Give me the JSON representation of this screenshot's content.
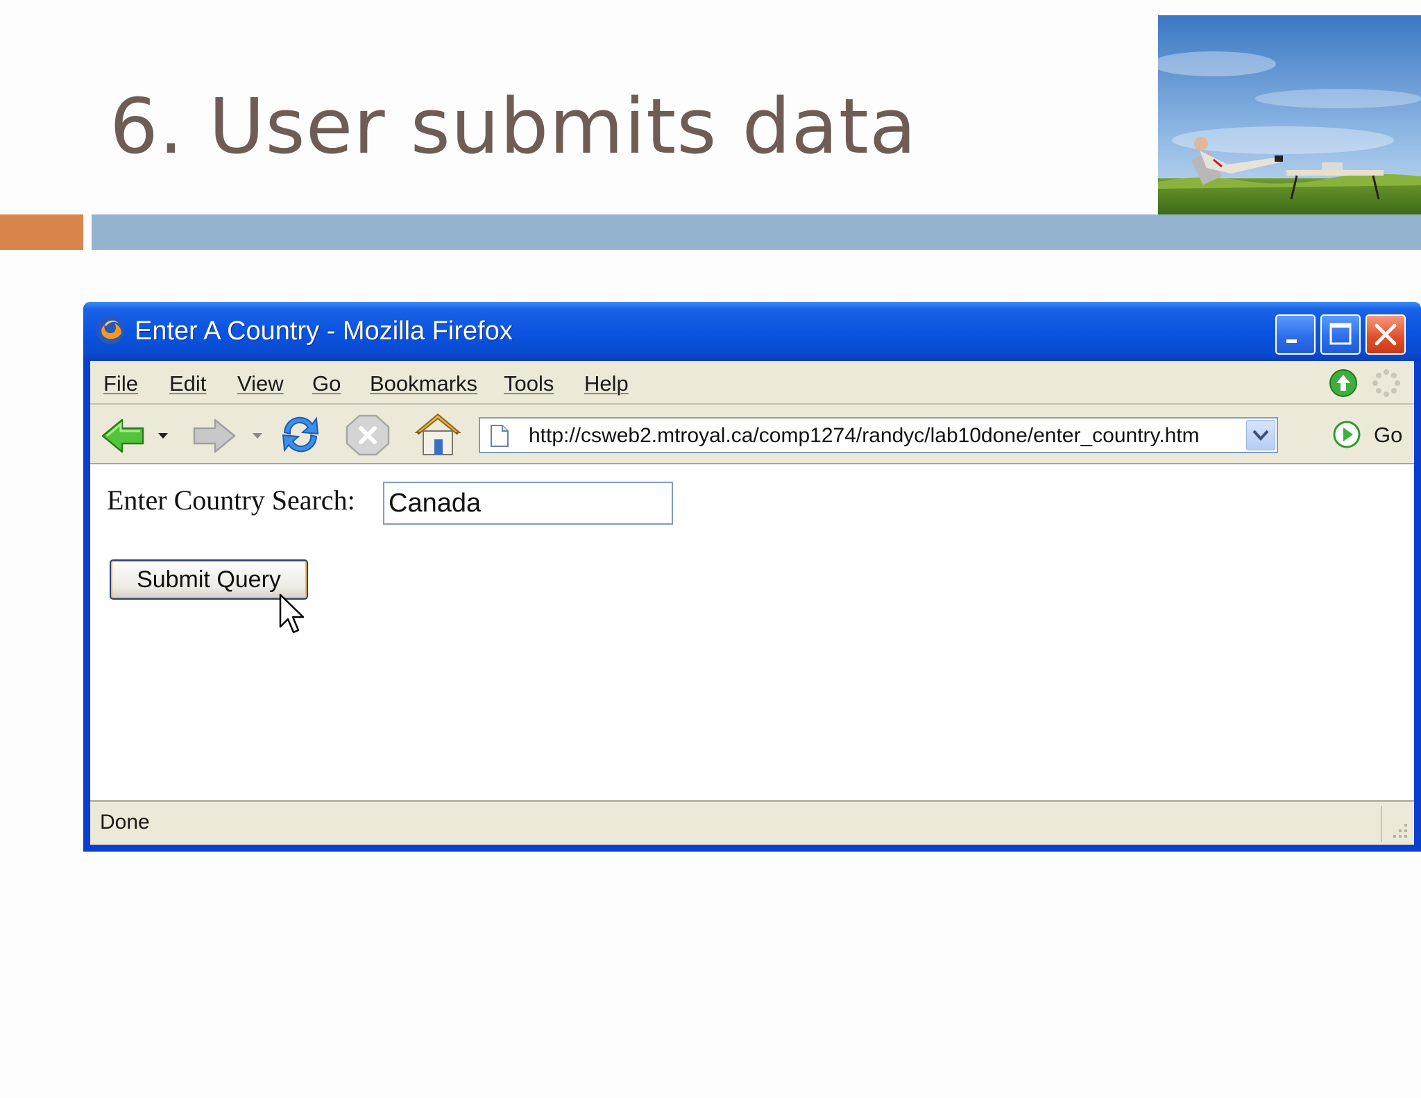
{
  "slide": {
    "title": "6. User submits data"
  },
  "colors": {
    "title": "#6f5d55",
    "accent_orange": "#d9864c",
    "accent_blue": "#95b4cf",
    "xp_blue": "#0a4bd1",
    "xp_chrome": "#ece9d8"
  },
  "browser": {
    "window_title": "Enter A Country - Mozilla Firefox",
    "menu": [
      "File",
      "Edit",
      "View",
      "Go",
      "Bookmarks",
      "Tools",
      "Help"
    ],
    "toolbar": {
      "icons": [
        "back-icon",
        "dropdown-arrow-icon",
        "forward-icon",
        "dropdown-arrow-icon",
        "reload-icon",
        "stop-icon",
        "home-icon"
      ],
      "url": "http://csweb2.mtroyal.ca/comp1274/randyc/lab10done/enter_country.htm",
      "go_label": "Go"
    },
    "page": {
      "label": "Enter Country Search:",
      "input_value": "Canada",
      "submit_label": "Submit Query"
    },
    "status": "Done"
  }
}
